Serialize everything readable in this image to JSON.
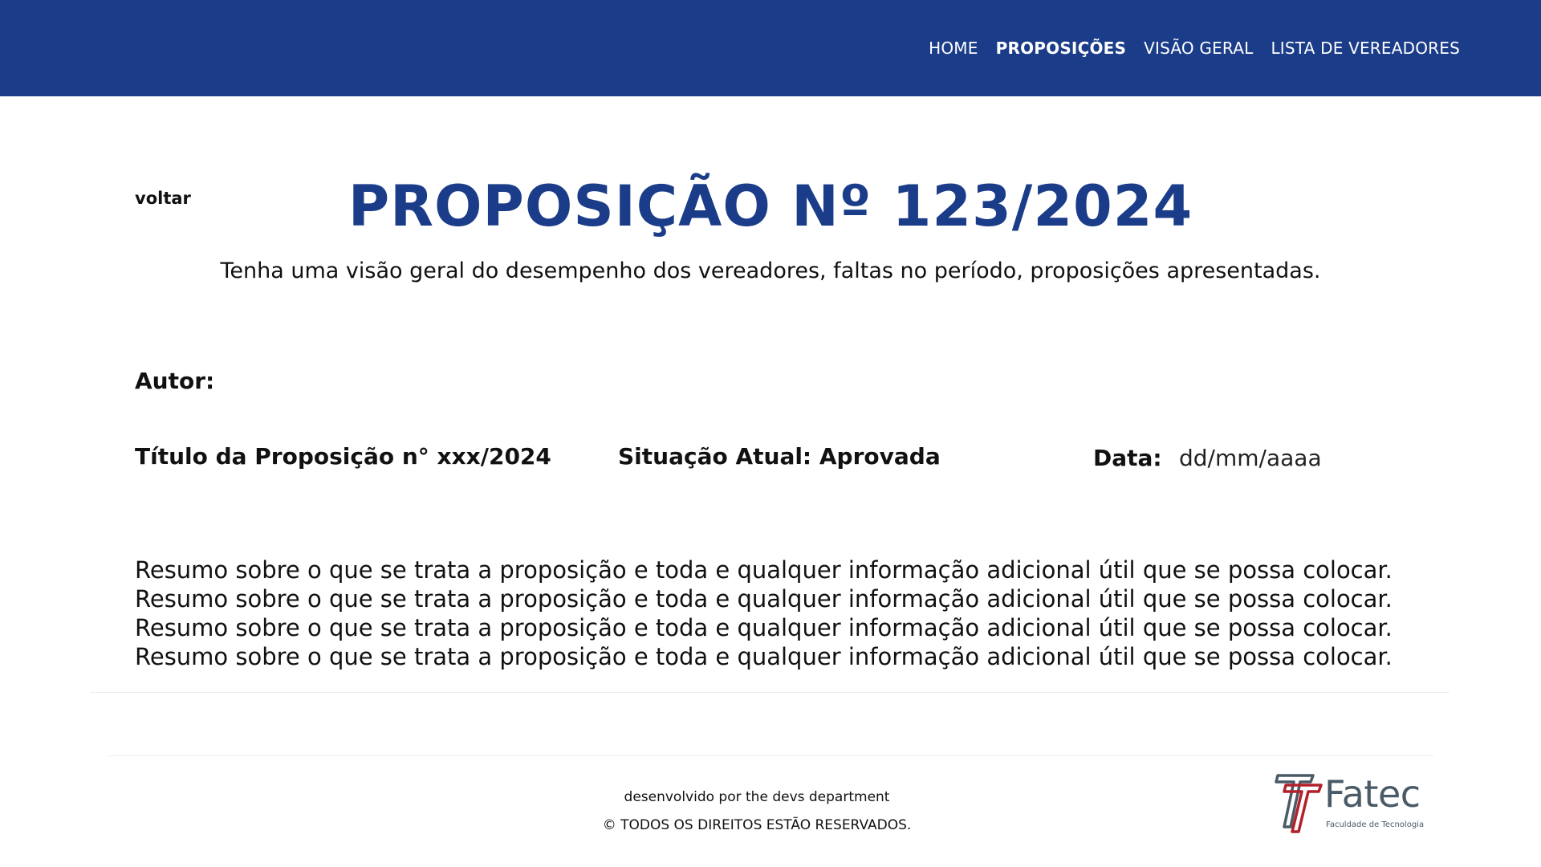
{
  "nav": {
    "items": [
      {
        "label": "HOME",
        "active": false
      },
      {
        "label": "PROPOSIÇÕES",
        "active": true
      },
      {
        "label": "VISÃO GERAL",
        "active": false
      },
      {
        "label": "LISTA DE VEREADORES",
        "active": false
      }
    ]
  },
  "back_link": "voltar",
  "page_title": "PROPOSIÇÃO Nº 123/2024",
  "subtitle": "Tenha uma visão geral do desempenho dos vereadores, faltas no período, proposições apresentadas.",
  "details": {
    "author_label": "Autor:",
    "proposition_title": "Título da Proposição n° xxx/2024",
    "status": "Situação Atual: Aprovada",
    "date_label": "Data:",
    "date_value": "dd/mm/aaaa"
  },
  "summary": [
    "Resumo sobre o que se trata a proposição e toda e qualquer informação adicional útil que se possa colocar.",
    "Resumo sobre o que se trata a proposição e toda e qualquer informação adicional útil que se possa colocar.",
    "Resumo sobre o que se trata a proposição e toda e qualquer informação adicional útil que se possa colocar.",
    "Resumo sobre o que se trata a proposição e toda e qualquer informação adicional útil que se possa colocar."
  ],
  "footer": {
    "developed_by": "desenvolvido por the devs department",
    "rights": "© TODOS OS DIREITOS ESTÃO RESERVADOS."
  },
  "logo": {
    "name": "Fatec",
    "subtitle": "Faculdade de Tecnologia",
    "icon": "fatec-logo-icon"
  },
  "colors": {
    "brand_blue": "#1b3d89",
    "logo_red": "#b3202a",
    "logo_gray": "#4a5a66"
  }
}
